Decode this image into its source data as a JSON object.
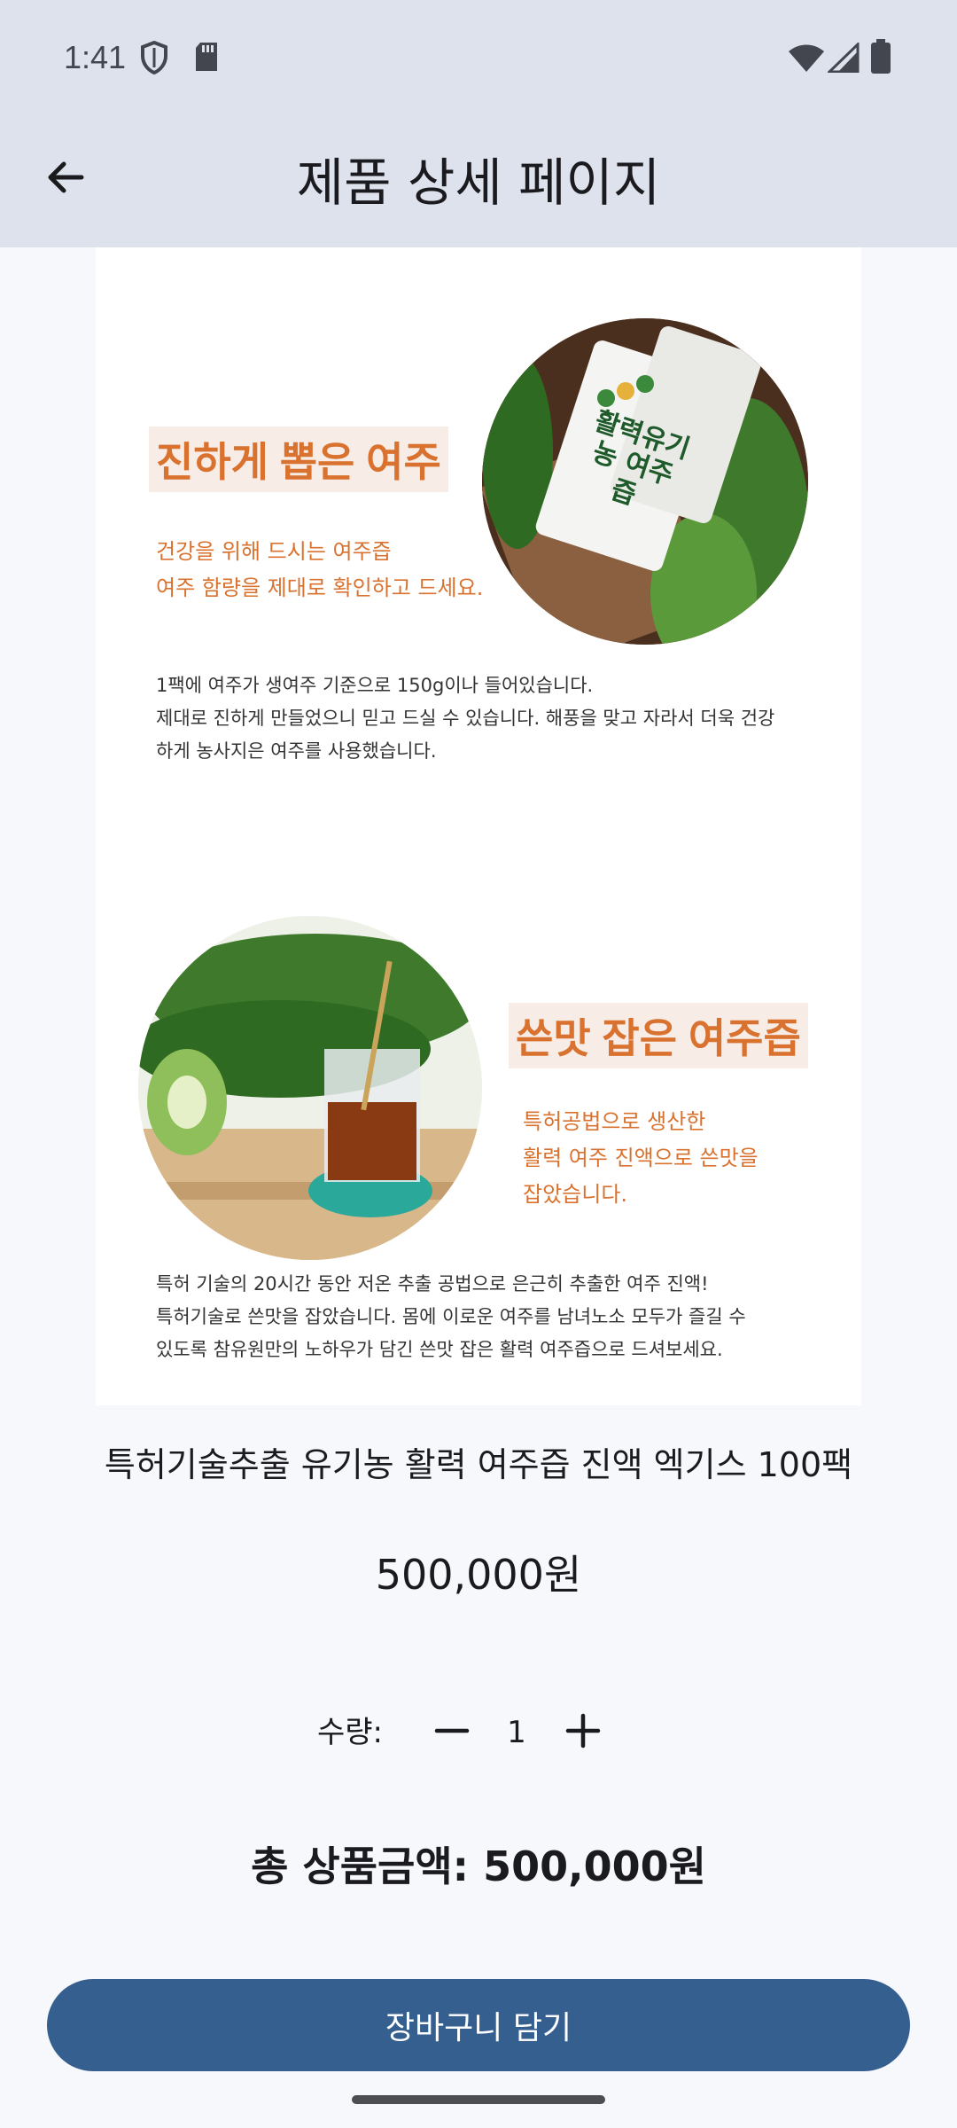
{
  "status_bar": {
    "time": "1:41",
    "icons": [
      "shield-icon",
      "sd-card-icon",
      "wifi-icon",
      "signal-icon",
      "battery-icon"
    ]
  },
  "app_bar": {
    "title": "제품 상세 페이지",
    "back_icon": "arrow-back-icon"
  },
  "product_image": {
    "section1": {
      "title": "진하게 뽑은 여주",
      "subtitle_lines": [
        "건강을 위해 드시는 여주즙",
        "여주 함량을 제대로 확인하고 드세요."
      ],
      "body_lines": [
        "1팩에 여주가 생여주 기준으로 150g이나 들어있습니다.",
        "제대로 진하게 만들었으니 믿고 드실 수 있습니다. 해풍을 맞고 자라서 더욱 건강",
        "하게 농사지은 여주를 사용했습니다."
      ],
      "package_text": "활력유기농 여주즙"
    },
    "section2": {
      "title": "쓴맛 잡은 여주즙",
      "subtitle_lines": [
        "특허공법으로 생산한",
        "활력 여주 진액으로 쓴맛을",
        "잡았습니다."
      ],
      "body_lines": [
        "특허 기술의 20시간 동안 저온 추출 공법으로 은근히 추출한 여주 진액!",
        "특허기술로 쓴맛을 잡았습니다. 몸에 이로운 여주를 남녀노소 모두가 즐길 수",
        "있도록 참유원만의 노하우가 담긴 쓴맛 잡은 활력 여주즙으로 드셔보세요."
      ]
    }
  },
  "product": {
    "name": "특허기술추출 유기농 활력 여주즙 진액 엑기스 100팩",
    "price": "500,000원"
  },
  "quantity": {
    "label": "수량:",
    "value": "1",
    "minus_icon": "minus-icon",
    "plus_icon": "plus-icon"
  },
  "total": {
    "text": "총 상품금액: 500,000원"
  },
  "cart_button": {
    "label": "장바구니 담기"
  },
  "colors": {
    "app_bar_bg": "#dde2ec",
    "page_bg": "#f6f8fc",
    "accent_orange": "#d9722f",
    "button_bg": "#355f8f"
  }
}
